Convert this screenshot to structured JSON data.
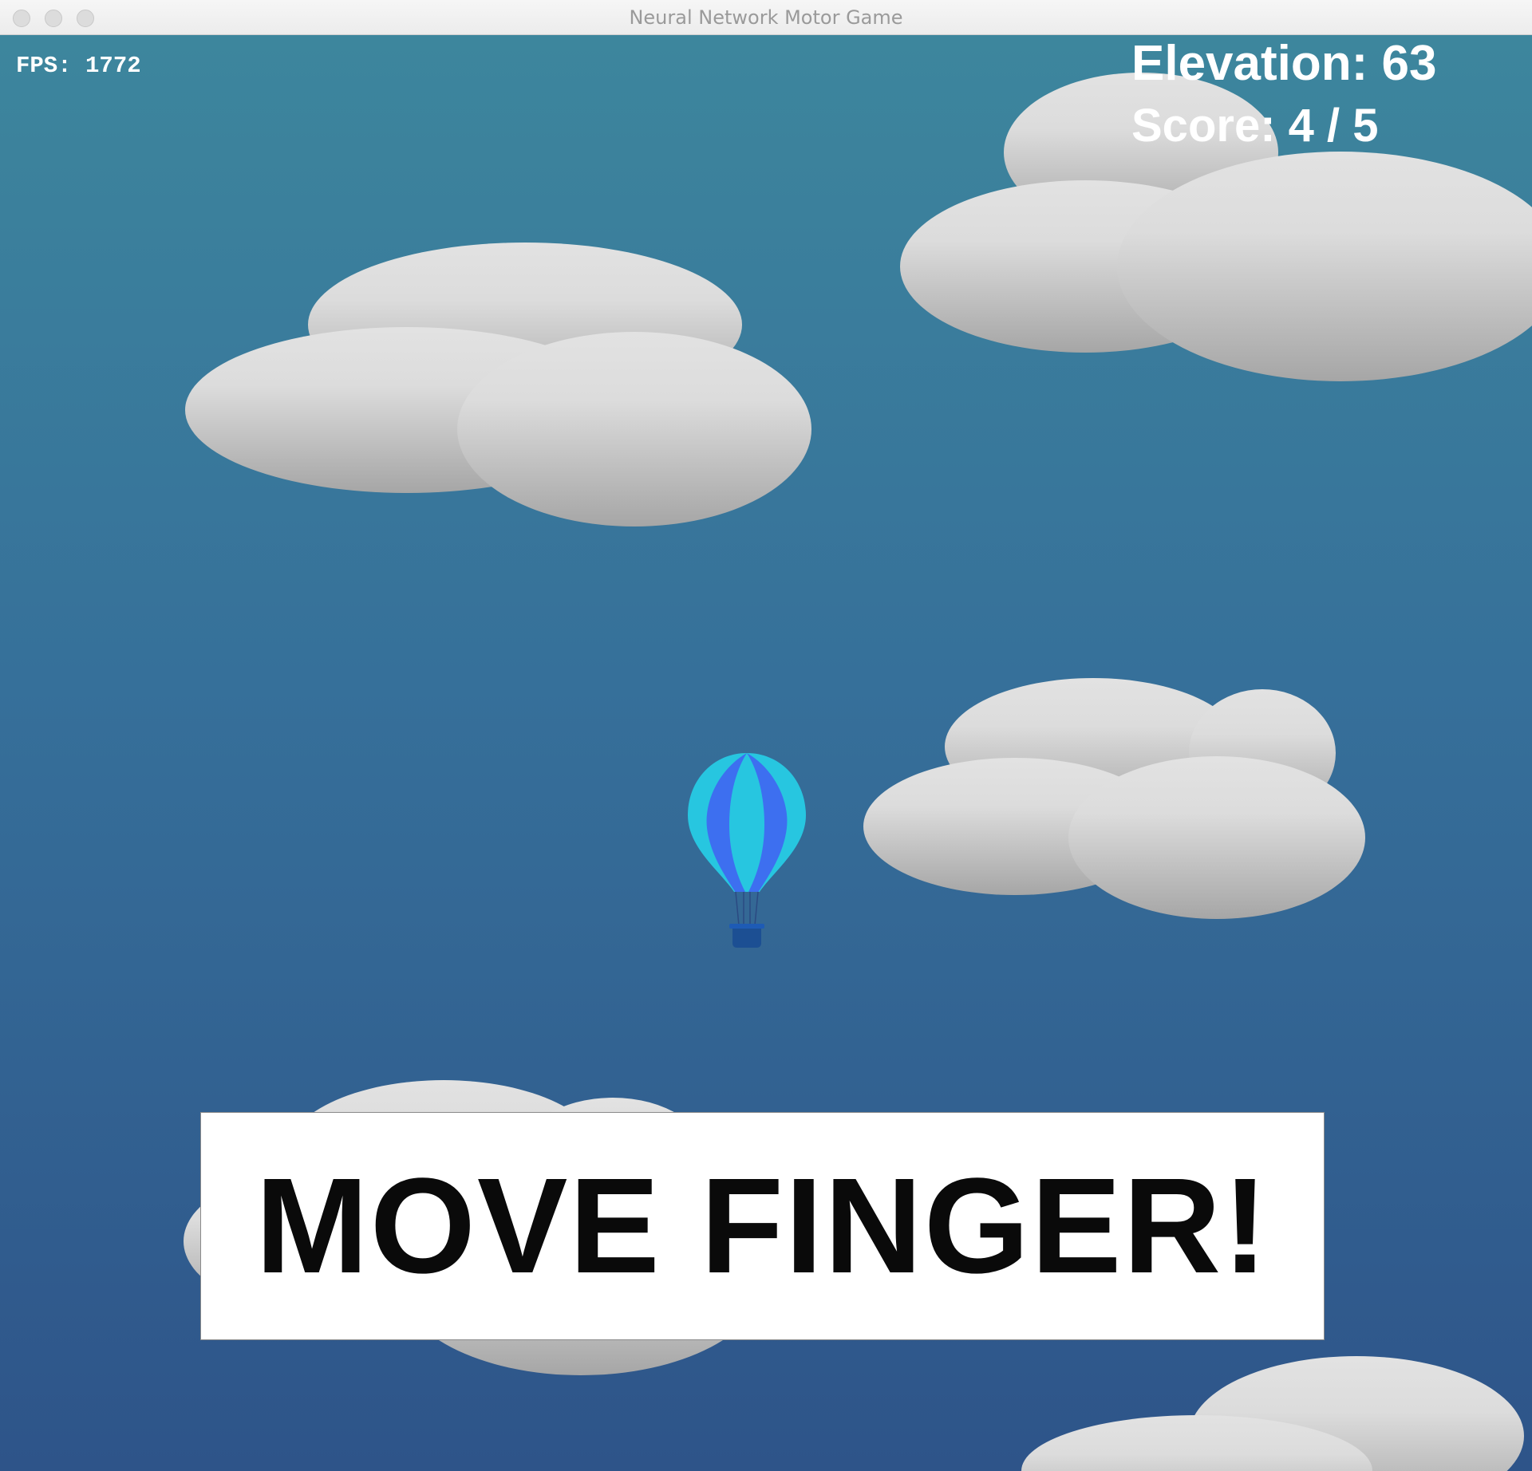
{
  "window": {
    "title": "Neural Network Motor Game"
  },
  "hud": {
    "fps": "FPS: 1772",
    "elevation": "Elevation: 63",
    "score": "Score: 4 / 5"
  },
  "prompt": {
    "text": "MOVE FINGER!"
  },
  "colors": {
    "sky_top": "#3d869d",
    "sky_bottom": "#2e5489",
    "cloud_light": "#e2e2e2",
    "cloud_dark": "#a6a6a6",
    "balloon_cyan": "#27c6e0",
    "balloon_blue": "#3d6ff0",
    "basket": "#1c4f93"
  }
}
